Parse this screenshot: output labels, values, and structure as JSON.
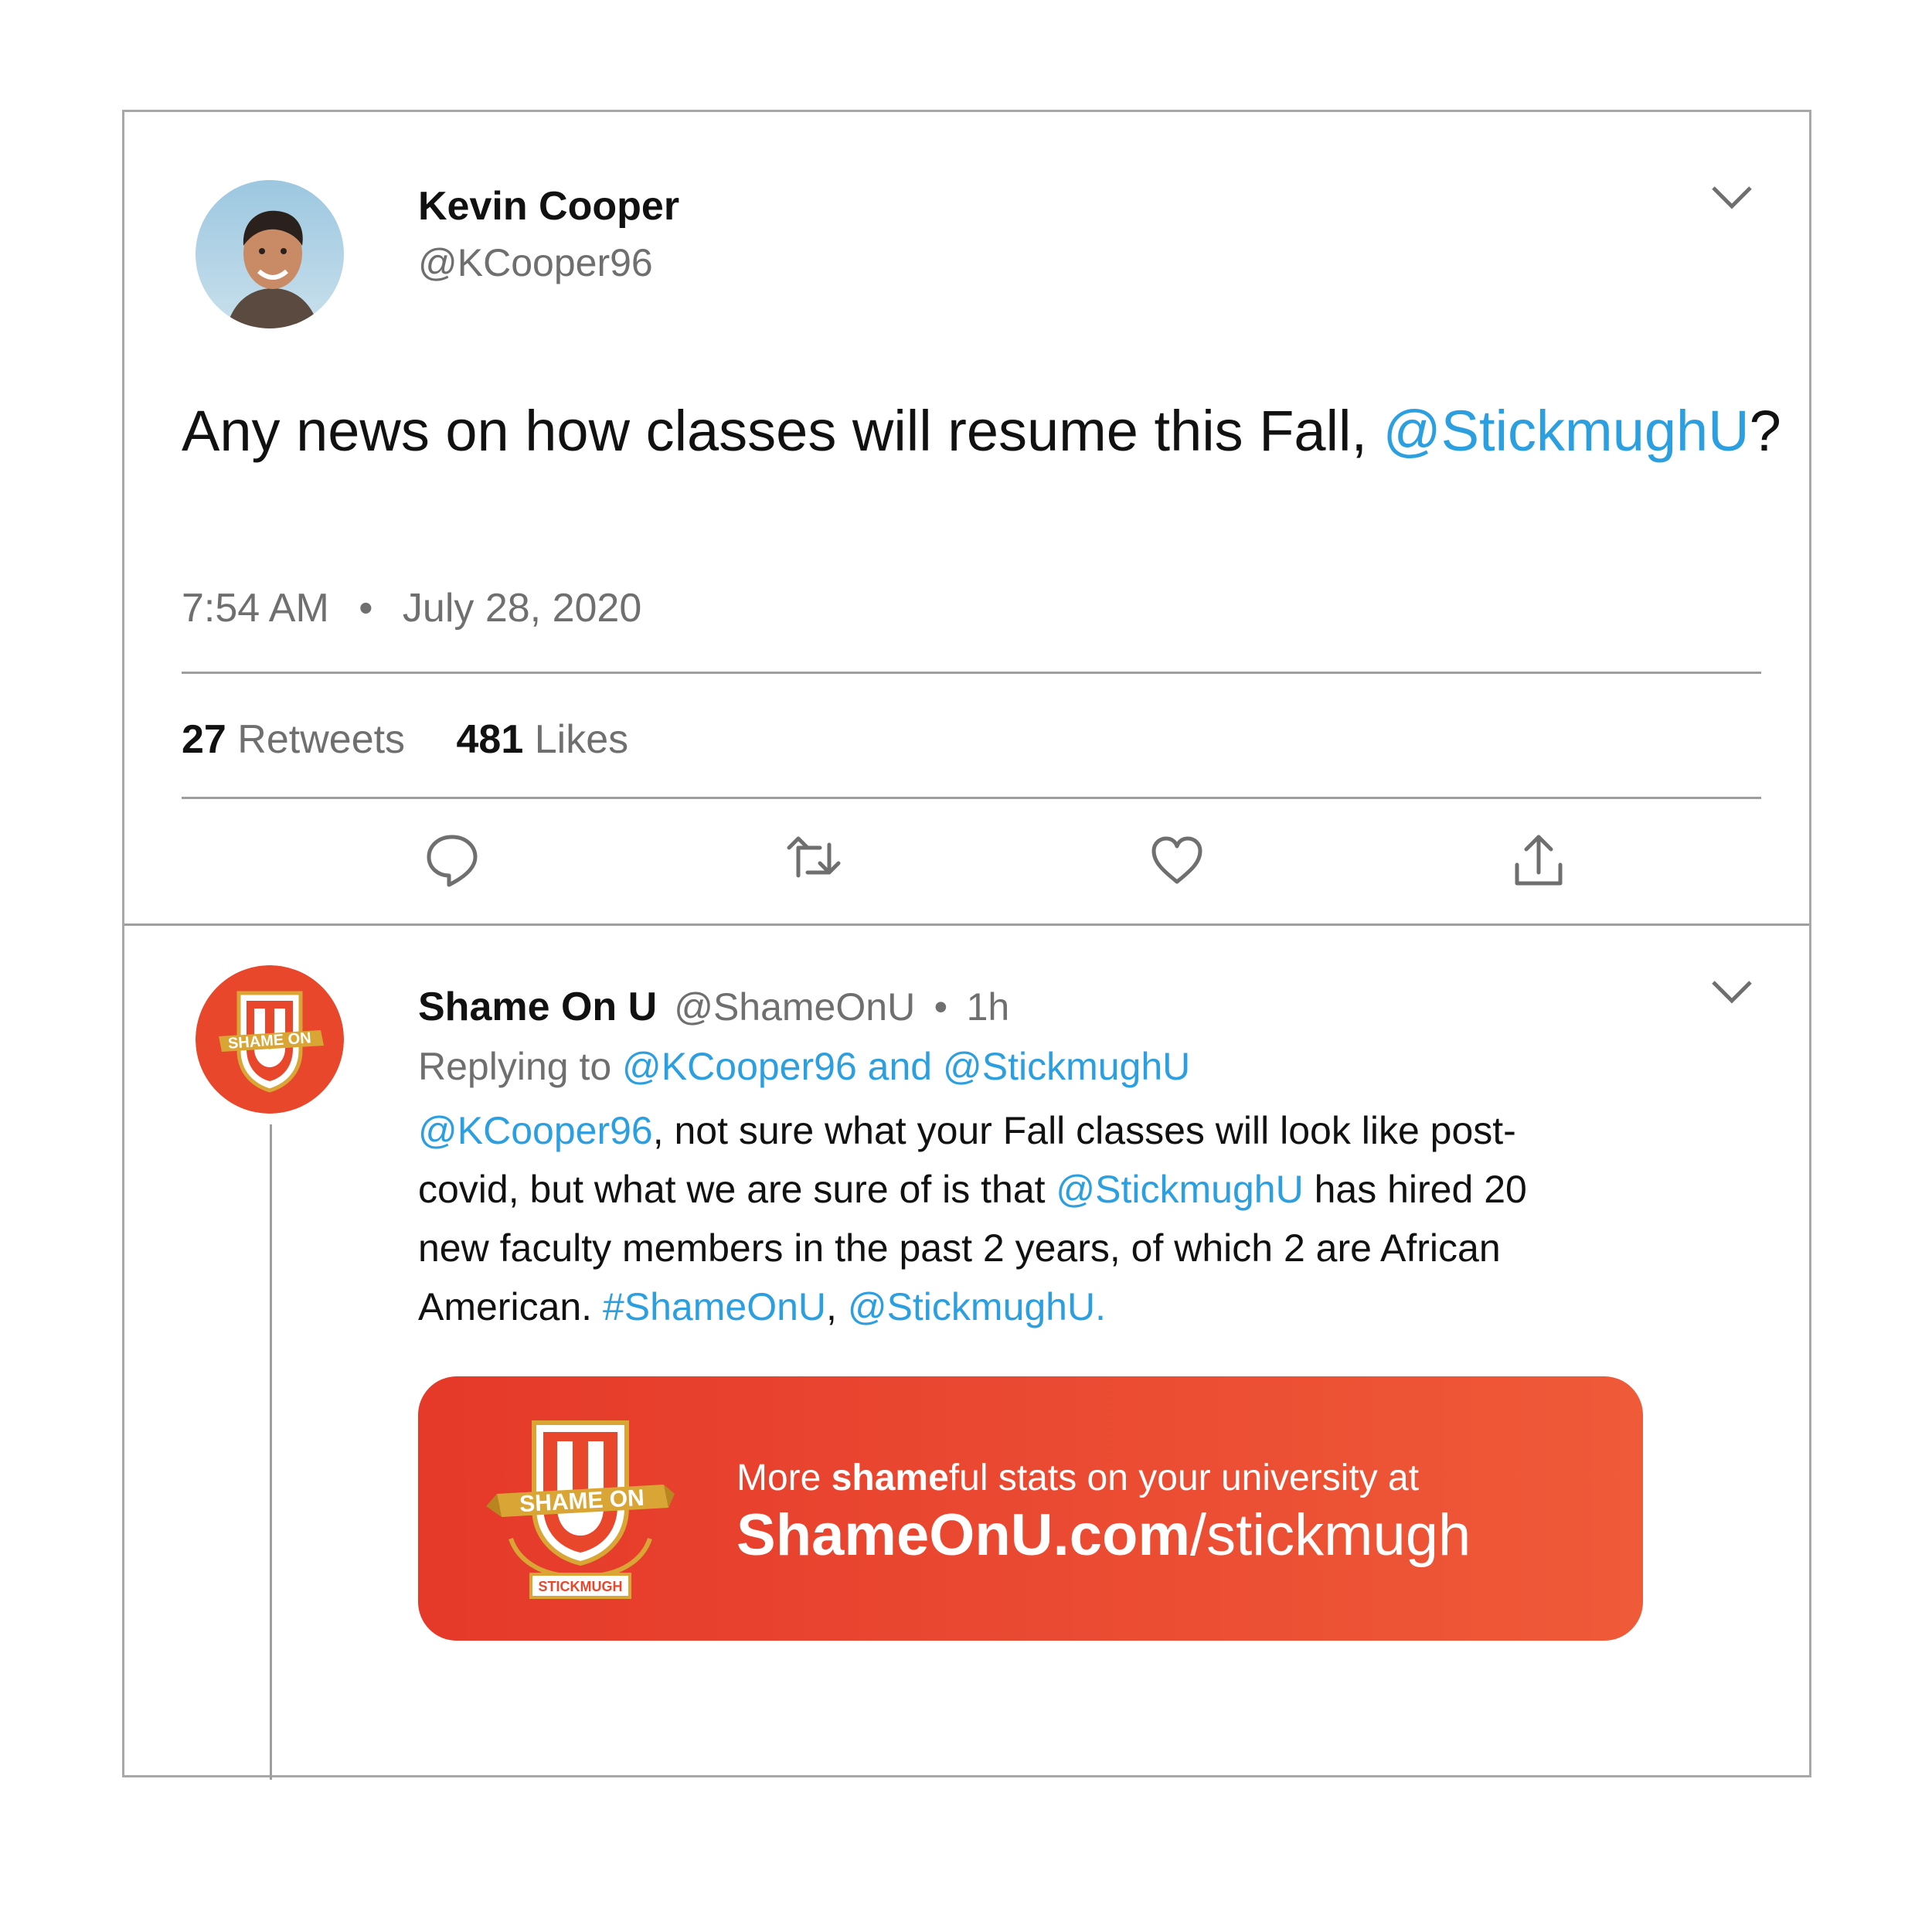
{
  "tweet": {
    "author_name": "Kevin Cooper",
    "author_handle": "@KCooper96",
    "text_prefix": "Any news on how classes will resume this Fall, ",
    "text_mention": "@StickmughU",
    "text_suffix": "?",
    "time": "7:54 AM",
    "separator": "•",
    "date": "July 28, 2020",
    "retweets_count": "27",
    "retweets_label": "Retweets",
    "likes_count": "481",
    "likes_label": "Likes",
    "actions": [
      "reply-icon",
      "retweet-icon",
      "like-icon",
      "share-icon"
    ]
  },
  "reply": {
    "author_name": "Shame On U",
    "author_handle": "@ShameOnU",
    "separator": "•",
    "age": "1h",
    "replying_label": "Replying to ",
    "replying_targets": "@KCooper96 and @StickmughU",
    "body": {
      "mention1": "@KCooper96",
      "text1": ", not sure what your Fall classes will look like post-covid, but what we are sure of is that ",
      "mention2": "@StickmughU",
      "text2": " has hired 20 new faculty members in the past 2 years, of which 2 are African American. ",
      "hashtag": "#ShameOnU",
      "comma": ", ",
      "mention3": "@StickmughU."
    },
    "avatar_badge_text": "SHAME ON",
    "avatar_badge_letter": "U"
  },
  "card": {
    "line1_prefix": "More ",
    "line1_bold": "shame",
    "line1_suffix": "ful stats on your university at",
    "line2_bold": "ShameOnU.com",
    "line2_rest": "/stickmugh",
    "logo_banner_text": "SHAME ON",
    "logo_letter": "U",
    "logo_ribbon_text": "STICKMUGH"
  },
  "colors": {
    "link": "#2b9fe0",
    "brand_orange": "#e8472c",
    "gold": "#d9a636",
    "border": "#a8a8a8"
  }
}
